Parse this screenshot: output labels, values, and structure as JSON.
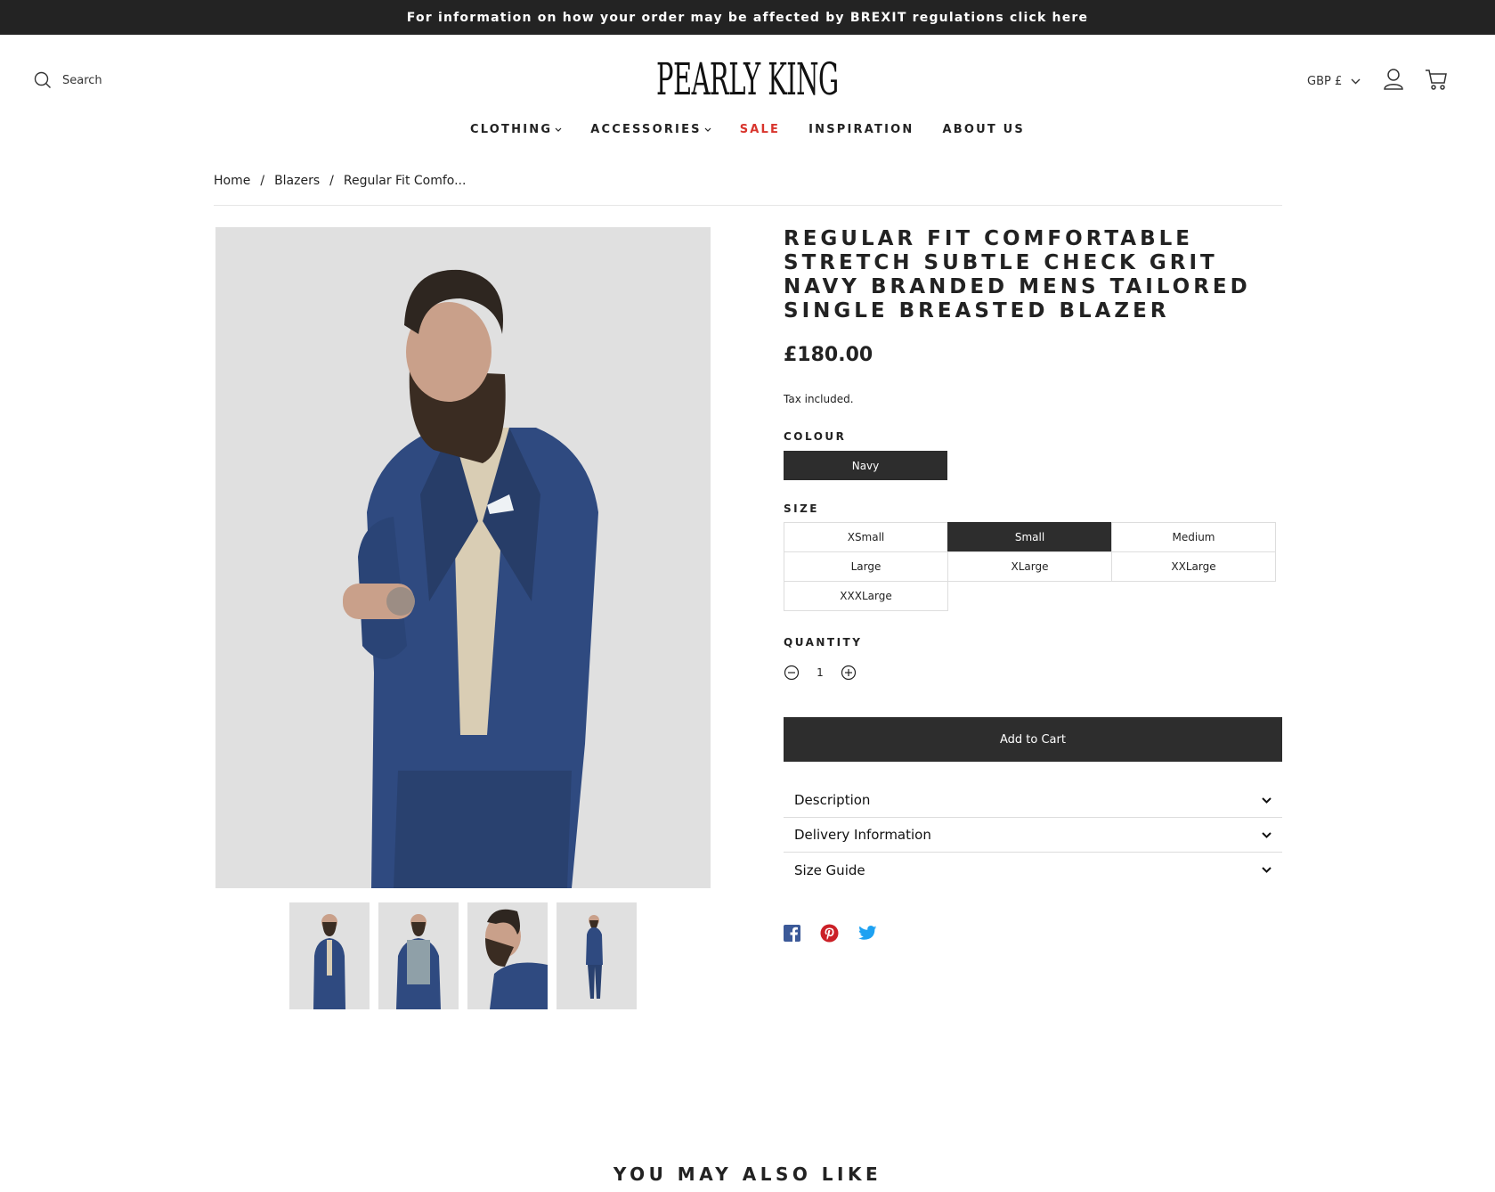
{
  "announcement": "For information on how your order may be affected by BREXIT regulations click here",
  "header": {
    "search_label": "Search",
    "logo_text": "PEARLY KING",
    "currency": "GBP £"
  },
  "nav": {
    "clothing": "CLOTHING",
    "accessories": "ACCESSORIES",
    "sale": "SALE",
    "inspiration": "INSPIRATION",
    "about": "ABOUT US"
  },
  "breadcrumb": {
    "home": "Home",
    "sep": "/",
    "category": "Blazers",
    "current": "Regular Fit Comfo..."
  },
  "product": {
    "title": "REGULAR FIT COMFORTABLE STRETCH SUBTLE CHECK GRIT NAVY BRANDED MENS TAILORED SINGLE BREASTED BLAZER",
    "price": "£180.00",
    "tax_note": "Tax included.",
    "colour_label": "COLOUR",
    "colour_value": "Navy",
    "size_label": "SIZE",
    "sizes": [
      "XSmall",
      "Small",
      "Medium",
      "Large",
      "XLarge",
      "XXLarge",
      "XXXLarge"
    ],
    "selected_size": "Small",
    "quantity_label": "QUANTITY",
    "quantity": "1",
    "add_to_cart": "Add to Cart",
    "accordions": [
      "Description",
      "Delivery Information",
      "Size Guide"
    ]
  },
  "social": {
    "facebook_color": "#3b5998",
    "pinterest_color": "#cb2027",
    "twitter_color": "#1da1f2"
  },
  "also_like": "YOU MAY ALSO LIKE",
  "colors": {
    "dark": "#2d2d2d",
    "sale": "#d8342c",
    "suit": "#2f4a80"
  }
}
